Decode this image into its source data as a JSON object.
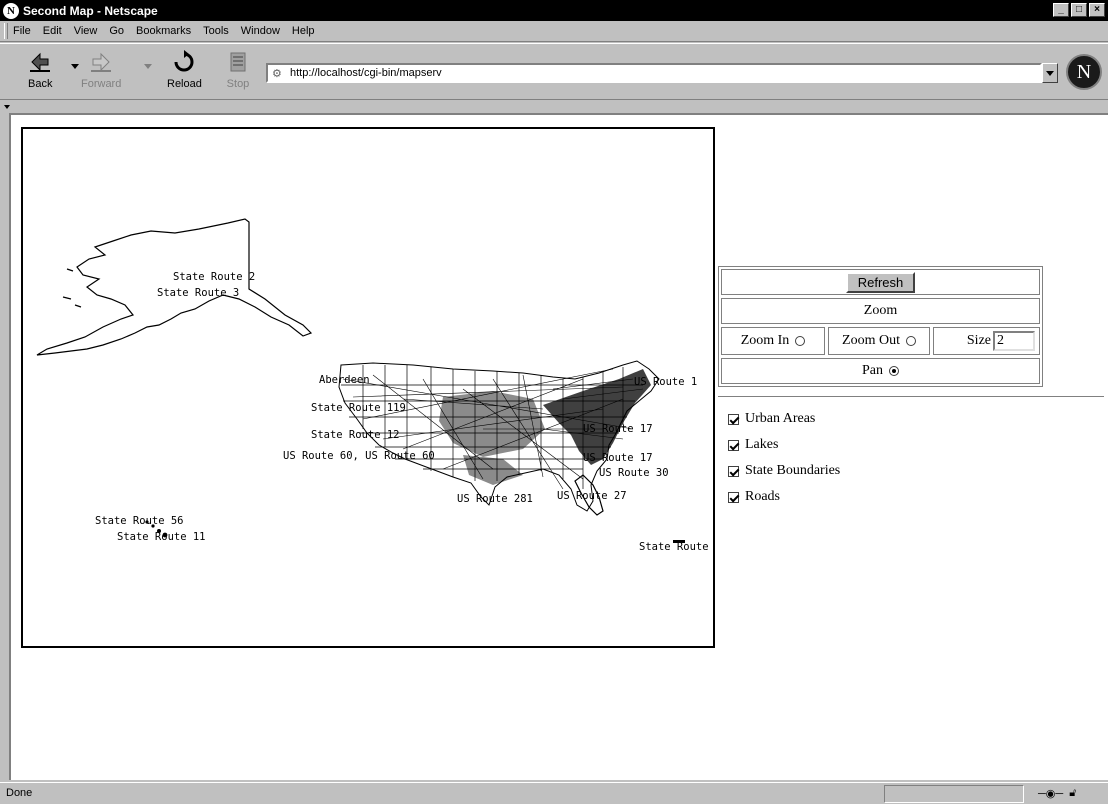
{
  "window": {
    "title": "Second Map - Netscape",
    "icon": "netscape-n-icon",
    "app_glyph": "N"
  },
  "window_buttons": [
    "_",
    "□",
    "×"
  ],
  "menu": [
    "File",
    "Edit",
    "View",
    "Go",
    "Bookmarks",
    "Tools",
    "Window",
    "Help"
  ],
  "toolbar": {
    "back": "Back",
    "forward": "Forward",
    "reload": "Reload",
    "stop": "Stop",
    "url": "http://localhost/cgi-bin/mapserv",
    "logo_glyph": "N"
  },
  "map": {
    "labels": [
      "State Route 2",
      "State Route 3",
      "US Route 1",
      "Aberdeen",
      "State Route 119",
      "State Route 12",
      "US Route 60, US Route 60",
      "US Route 17",
      "US Route 17",
      "US Route 30",
      "US Route 281",
      "US Route 27",
      "State Route 56",
      "State Route 11",
      "State Route"
    ]
  },
  "controls": {
    "refresh_label": "Refresh",
    "zoom_label": "Zoom",
    "zoom_in_label": "Zoom In",
    "zoom_out_label": "Zoom Out",
    "size_label": "Size",
    "size_value": "2",
    "pan_label": "Pan",
    "selected_mode": "pan"
  },
  "layers": [
    {
      "label": "Urban Areas",
      "checked": true
    },
    {
      "label": "Lakes",
      "checked": true
    },
    {
      "label": "State Boundaries",
      "checked": true
    },
    {
      "label": "Roads",
      "checked": true
    }
  ],
  "status": {
    "text": "Done"
  }
}
